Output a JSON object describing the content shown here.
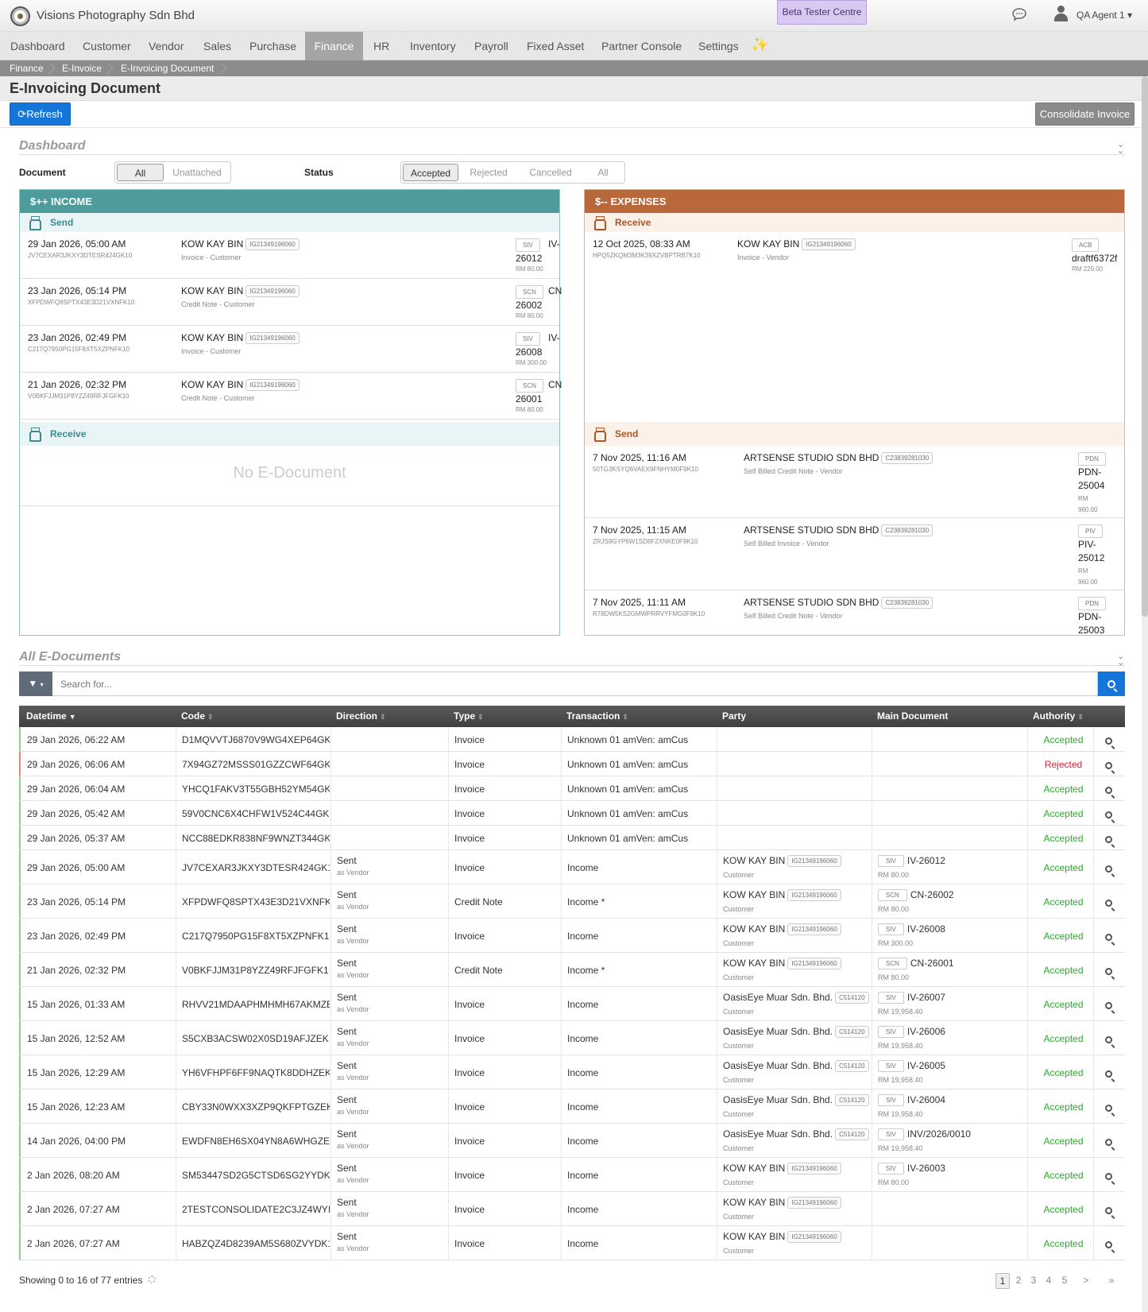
{
  "app": {
    "name": "Visions Photography Sdn Bhd",
    "beta": "Beta Tester Centre",
    "user": "QA Agent 1"
  },
  "nav": [
    "Dashboard",
    "Customer",
    "Vendor",
    "Sales",
    "Purchase",
    "Finance",
    "HR",
    "Inventory",
    "Payroll",
    "Fixed Asset",
    "Partner Console",
    "Settings"
  ],
  "nav_active": "Finance",
  "breadcrumb": [
    "Finance",
    "E-Invoice",
    "E-Invoicing Document"
  ],
  "page_title": "E-Invoicing Document",
  "buttons": {
    "refresh": "Refresh",
    "consolidate": "Consolidate Invoice"
  },
  "dashboard": {
    "title": "Dashboard",
    "document_label": "Document",
    "document_options": [
      "All",
      "Unattached"
    ],
    "document_selected": "All",
    "status_label": "Status",
    "status_options": [
      "Accepted",
      "Rejected",
      "Cancelled",
      "All"
    ],
    "status_selected": "Accepted"
  },
  "income": {
    "title": "$++ INCOME",
    "send_label": "Send",
    "receive_label": "Receive",
    "no_doc": "No E-Document",
    "send": [
      {
        "dt": "29 Jan 2026, 05:00 AM",
        "code": "JV7CEXAR3JKXY3DTESR424GK10",
        "party": "KOW KAY BIN",
        "tin": "IG21349196060",
        "type": "Invoice - Customer",
        "box": "SIV",
        "doc1": "IV-",
        "doc2": "26012",
        "amt": "RM 80.00"
      },
      {
        "dt": "23 Jan 2026, 05:14 PM",
        "code": "XFPDWFQ8SPTX43E3D21VXNFK10",
        "party": "KOW KAY BIN",
        "tin": "IG21349196060",
        "type": "Credit Note - Customer",
        "box": "SCN",
        "doc1": "CN",
        "doc2": "26002",
        "amt": "RM 80.00"
      },
      {
        "dt": "23 Jan 2026, 02:49 PM",
        "code": "C217Q7950PG15F8XT5XZPNFK10",
        "party": "KOW KAY BIN",
        "tin": "IG21349196060",
        "type": "Invoice - Customer",
        "box": "SIV",
        "doc1": "IV-",
        "doc2": "26008",
        "amt": "RM 300.00"
      },
      {
        "dt": "21 Jan 2026, 02:32 PM",
        "code": "V0BKFJJM31P8YZZ49RFJFGFK10",
        "party": "KOW KAY BIN",
        "tin": "IG21349196060",
        "type": "Credit Note - Customer",
        "box": "SCN",
        "doc1": "CN",
        "doc2": "26001",
        "amt": "RM 80.00"
      }
    ]
  },
  "expenses": {
    "title": "$-- EXPENSES",
    "receive_label": "Receive",
    "send_label": "Send",
    "receive": [
      {
        "dt": "12 Oct 2025, 08:33 AM",
        "code": "HPQ5ZKQM3M3K39XZVBPTRB7K10",
        "party": "KOW KAY BIN",
        "tin": "IG21349196060",
        "type": "Invoice - Vendor",
        "box": "ACB",
        "doc": "draftf6372f",
        "amt": "RM 220.00"
      }
    ],
    "send": [
      {
        "dt": "7 Nov 2025, 11:16 AM",
        "code": "50TG3KSYQ6VAEX9FNHYM0F9K10",
        "party": "ARTSENSE STUDIO SDN BHD",
        "tin": "C23839281030",
        "type": "Self Billed Credit Note - Vendor",
        "box": "PDN",
        "doc1": "PDN-",
        "doc2": "25004",
        "amt1": "RM",
        "amt2": "960.00"
      },
      {
        "dt": "7 Nov 2025, 11:15 AM",
        "code": "ZRJS9GYP6W1SD8F2XNKE0F9K10",
        "party": "ARTSENSE STUDIO SDN BHD",
        "tin": "C23839281030",
        "type": "Self Billed Invoice - Vendor",
        "box": "PIV",
        "doc1": "PIV-",
        "doc2": "25012",
        "amt1": "RM",
        "amt2": "960.00"
      },
      {
        "dt": "7 Nov 2025, 11:11 AM",
        "code": "R78DW5KS2GMWPRRVYFMG0F9K10",
        "party": "ARTSENSE STUDIO SDN BHD",
        "tin": "C23839281030",
        "type": "Self Billed Credit Note - Vendor",
        "box": "PDN",
        "doc1": "PDN-",
        "doc2": "25003",
        "amt1": "",
        "amt2": ""
      }
    ]
  },
  "all_docs": {
    "title": "All E-Documents",
    "search_placeholder": "Search for...",
    "columns": [
      "Datetime",
      "Code",
      "Direction",
      "Type",
      "Transaction",
      "Party",
      "Main Document",
      "Authority"
    ],
    "rows": [
      {
        "dt": "29 Jan 2026, 06:22 AM",
        "code": "D1MQVVTJ6870V9WG4XEP64GK",
        "dir": "",
        "dir_sub": "",
        "type": "Invoice",
        "txn": "Unknown 01 amVen: amCus",
        "party": "",
        "tin": "",
        "role": "",
        "box": "",
        "doc": "",
        "amt": "",
        "auth": "Accepted"
      },
      {
        "dt": "29 Jan 2026, 06:06 AM",
        "code": "7X94GZ72MSSS01GZZCWF64GK",
        "dir": "",
        "dir_sub": "",
        "type": "Invoice",
        "txn": "Unknown 01 amVen: amCus",
        "party": "",
        "tin": "",
        "role": "",
        "box": "",
        "doc": "",
        "amt": "",
        "auth": "Rejected"
      },
      {
        "dt": "29 Jan 2026, 06:04 AM",
        "code": "YHCQ1FAKV3T55GBH52YM54GK",
        "dir": "",
        "dir_sub": "",
        "type": "Invoice",
        "txn": "Unknown 01 amVen: amCus",
        "party": "",
        "tin": "",
        "role": "",
        "box": "",
        "doc": "",
        "amt": "",
        "auth": "Accepted"
      },
      {
        "dt": "29 Jan 2026, 05:42 AM",
        "code": "59V0CNC6X4CHFW1V524C44GK",
        "dir": "",
        "dir_sub": "",
        "type": "Invoice",
        "txn": "Unknown 01 amVen: amCus",
        "party": "",
        "tin": "",
        "role": "",
        "box": "",
        "doc": "",
        "amt": "",
        "auth": "Accepted"
      },
      {
        "dt": "29 Jan 2026, 05:37 AM",
        "code": "NCC88EDKR838NF9WNZT344GK",
        "dir": "",
        "dir_sub": "",
        "type": "Invoice",
        "txn": "Unknown 01 amVen: amCus",
        "party": "",
        "tin": "",
        "role": "",
        "box": "",
        "doc": "",
        "amt": "",
        "auth": "Accepted"
      },
      {
        "dt": "29 Jan 2026, 05:00 AM",
        "code": "JV7CEXAR3JKXY3DTESR424GK1",
        "dir": "Sent",
        "dir_sub": "as Vendor",
        "type": "Invoice",
        "txn": "Income",
        "party": "KOW KAY BIN",
        "tin": "IG21349196060",
        "role": "Customer",
        "box": "SIV",
        "doc": "IV-26012",
        "amt": "RM 80.00",
        "auth": "Accepted"
      },
      {
        "dt": "23 Jan 2026, 05:14 PM",
        "code": "XFPDWFQ8SPTX43E3D21VXNFK",
        "dir": "Sent",
        "dir_sub": "as Vendor",
        "type": "Credit Note",
        "txn": "Income *",
        "party": "KOW KAY BIN",
        "tin": "IG21349196060",
        "role": "Customer",
        "box": "SCN",
        "doc": "CN-26002",
        "amt": "RM 80.00",
        "auth": "Accepted"
      },
      {
        "dt": "23 Jan 2026, 02:49 PM",
        "code": "C217Q7950PG15F8XT5XZPNFK1",
        "dir": "Sent",
        "dir_sub": "as Vendor",
        "type": "Invoice",
        "txn": "Income",
        "party": "KOW KAY BIN",
        "tin": "IG21349196060",
        "role": "Customer",
        "box": "SIV",
        "doc": "IV-26008",
        "amt": "RM 300.00",
        "auth": "Accepted"
      },
      {
        "dt": "21 Jan 2026, 02:32 PM",
        "code": "V0BKFJJM31P8YZZ49RFJFGFK1",
        "dir": "Sent",
        "dir_sub": "as Vendor",
        "type": "Credit Note",
        "txn": "Income *",
        "party": "KOW KAY BIN",
        "tin": "IG21349196060",
        "role": "Customer",
        "box": "SCN",
        "doc": "CN-26001",
        "amt": "RM 80.00",
        "auth": "Accepted"
      },
      {
        "dt": "15 Jan 2026, 01:33 AM",
        "code": "RHVV21MDAAPHMHMH67AKMZE",
        "dir": "Sent",
        "dir_sub": "as Vendor",
        "type": "Invoice",
        "txn": "Income",
        "party": "OasisEye Muar Sdn. Bhd.",
        "tin": "C514120",
        "role": "Customer",
        "box": "SIV",
        "doc": "IV-26007",
        "amt": "RM 19,958.40",
        "auth": "Accepted"
      },
      {
        "dt": "15 Jan 2026, 12:52 AM",
        "code": "S5CXB3ACSW02X0SD19AFJZEK",
        "dir": "Sent",
        "dir_sub": "as Vendor",
        "type": "Invoice",
        "txn": "Income",
        "party": "OasisEye Muar Sdn. Bhd.",
        "tin": "C514120",
        "role": "Customer",
        "box": "SIV",
        "doc": "IV-26006",
        "amt": "RM 19,958.40",
        "auth": "Accepted"
      },
      {
        "dt": "15 Jan 2026, 12:29 AM",
        "code": "YH6VFHPF6FF9NAQTK8DDHZEK",
        "dir": "Sent",
        "dir_sub": "as Vendor",
        "type": "Invoice",
        "txn": "Income",
        "party": "OasisEye Muar Sdn. Bhd.",
        "tin": "C514120",
        "role": "Customer",
        "box": "SIV",
        "doc": "IV-26005",
        "amt": "RM 19,958.40",
        "auth": "Accepted"
      },
      {
        "dt": "15 Jan 2026, 12:23 AM",
        "code": "CBY33N0WXX3XZP9QKFPTGZEK",
        "dir": "Sent",
        "dir_sub": "as Vendor",
        "type": "Invoice",
        "txn": "Income",
        "party": "OasisEye Muar Sdn. Bhd.",
        "tin": "C514120",
        "role": "Customer",
        "box": "SIV",
        "doc": "IV-26004",
        "amt": "RM 19,958.40",
        "auth": "Accepted"
      },
      {
        "dt": "14 Jan 2026, 04:00 PM",
        "code": "EWDFN8EH6SX04YN8A6WHGZE",
        "dir": "Sent",
        "dir_sub": "as Vendor",
        "type": "Invoice",
        "txn": "Income",
        "party": "OasisEye Muar Sdn. Bhd.",
        "tin": "C514120",
        "role": "Customer",
        "box": "SIV",
        "doc": "INV/2026/0010",
        "amt": "RM 19,958.40",
        "auth": "Accepted"
      },
      {
        "dt": "2 Jan 2026, 08:20 AM",
        "code": "SM53447SD2G5CTSD6SG2YYDK",
        "dir": "Sent",
        "dir_sub": "as Vendor",
        "type": "Invoice",
        "txn": "Income",
        "party": "KOW KAY BIN",
        "tin": "IG21349196060",
        "role": "Customer",
        "box": "SIV",
        "doc": "IV-26003",
        "amt": "RM 80.00",
        "auth": "Accepted"
      },
      {
        "dt": "2 Jan 2026, 07:27 AM",
        "code": "2TESTCONSOLIDATE2C3JZ4WYI",
        "dir": "Sent",
        "dir_sub": "as Vendor",
        "type": "Invoice",
        "txn": "Income",
        "party": "KOW KAY BIN",
        "tin": "IG21349196060",
        "role": "Customer",
        "box": "",
        "doc": "",
        "amt": "",
        "auth": "Accepted"
      },
      {
        "dt": "2 Jan 2026, 07:27 AM",
        "code": "HABZQZ4D8239AM5S680ZVYDK1",
        "dir": "Sent",
        "dir_sub": "as Vendor",
        "type": "Invoice",
        "txn": "Income",
        "party": "KOW KAY BIN",
        "tin": "IG21349196060",
        "role": "Customer",
        "box": "",
        "doc": "",
        "amt": "",
        "auth": "Accepted"
      }
    ],
    "footer": "Showing 0 to 16 of 77 entries",
    "pages": [
      "1",
      "2",
      "3",
      "4",
      "5",
      ">",
      "»"
    ],
    "current_page": "1"
  },
  "colors": {
    "accent": "#1476d9",
    "income": "#4e9b9b",
    "expenses": "#b8683a",
    "accepted": "#2eaa2e",
    "rejected": "#d9263a"
  }
}
